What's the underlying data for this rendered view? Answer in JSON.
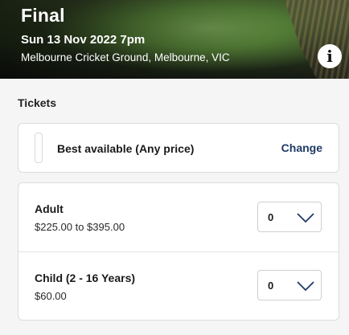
{
  "event": {
    "title": "Final",
    "datetime": "Sun 13 Nov 2022 7pm",
    "venue": "Melbourne Cricket Ground, Melbourne, VIC",
    "info_icon": "info-icon",
    "info_glyph": "i"
  },
  "tickets": {
    "section_label": "Tickets",
    "filter": {
      "label": "Best available (Any price)",
      "action": "Change"
    },
    "types": [
      {
        "name": "Adult",
        "price": "$225.00 to $395.00",
        "quantity": "0"
      },
      {
        "name": "Child (2 - 16 Years)",
        "price": "$60.00",
        "quantity": "0"
      }
    ]
  },
  "colors": {
    "link": "#1f3a66",
    "card_border": "#dcdcdc",
    "page_background": "#f5f5f6"
  }
}
